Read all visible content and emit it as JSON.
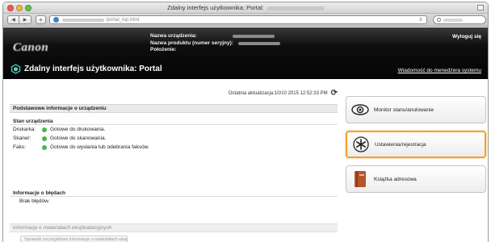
{
  "window": {
    "title": "Zdalny interfejs użytkownika: Portal:"
  },
  "toolbar": {
    "url_suffix": "/portal_top.html",
    "add_label": "+",
    "reload_label": "c",
    "back_label": "◀",
    "forward_label": "▶"
  },
  "header": {
    "device_name_label": "Nazwa urządzenia:",
    "product_name_label": "Nazwa produktu (numer seryjny):",
    "location_label": "Położenie:",
    "logout_label": "Wyloguj się",
    "portal_title": "Zdalny interfejs użytkownika: Portal",
    "admin_message_label": "Wiadomość do menedżera systemu"
  },
  "status": {
    "last_update_label": "Ostatnia aktualizacja:10/10 2015 12:52:33 PM",
    "basic_info_heading": "Podstawowe informacje o urządzeniu",
    "device_status_heading": "Stan urządzenia",
    "devices": [
      {
        "label": "Drukarka:",
        "status": "Gotowe do drukowania.",
        "color": "#4fb34f"
      },
      {
        "label": "Skaner:",
        "status": "Gotowe do skanowania.",
        "color": "#4fb34f"
      },
      {
        "label": "Faks:",
        "status": "Gotowe do wysłania lub odebrania faksów.",
        "color": "#4fb34f"
      }
    ],
    "error_heading": "Informacje o błędach",
    "error_text": "Brak błędów.",
    "consumables_heading": "Informacje o materiałach eksploatacyjnych",
    "consumables_button": "Sprawdź szczegółowe informacje o materiałach eksploatacyjnych"
  },
  "menu": {
    "items": [
      {
        "label": "Monitor stanu/anulowanie",
        "icon": "eye-icon",
        "active": false
      },
      {
        "label": "Ustawienia/rejestracja",
        "icon": "settings-asterisk-icon",
        "active": true
      },
      {
        "label": "Książka adresowa",
        "icon": "address-book-icon",
        "active": false
      }
    ],
    "accent_color": "#f0a22a"
  }
}
